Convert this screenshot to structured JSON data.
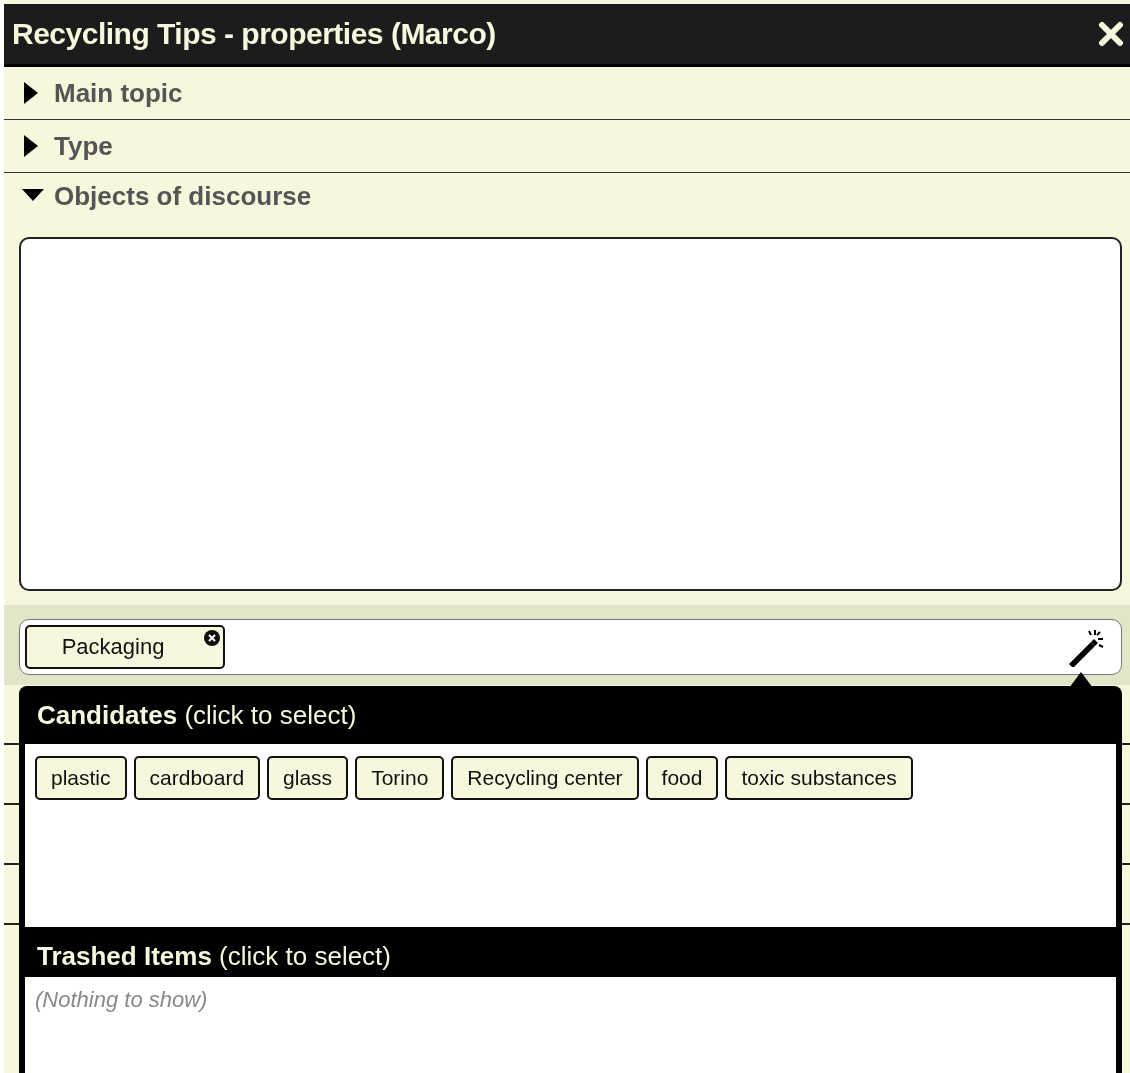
{
  "window": {
    "title": "Recycling Tips - properties (Marco)"
  },
  "sections": [
    {
      "label": "Main topic",
      "expanded": false
    },
    {
      "label": "Type",
      "expanded": false
    },
    {
      "label": "Objects of discourse",
      "expanded": true
    }
  ],
  "objects": {
    "tags": [
      {
        "label": "Packaging"
      }
    ]
  },
  "suggestions": {
    "candidates_heading": "**Candidates** (click to select)",
    "candidates": [
      "plastic",
      "cardboard",
      "glass",
      "Torino",
      "Recycling center",
      "food",
      "toxic substances"
    ],
    "trashed_heading": "**Trashed Items** (click to select)",
    "trashed_empty": "(Nothing to show)"
  }
}
